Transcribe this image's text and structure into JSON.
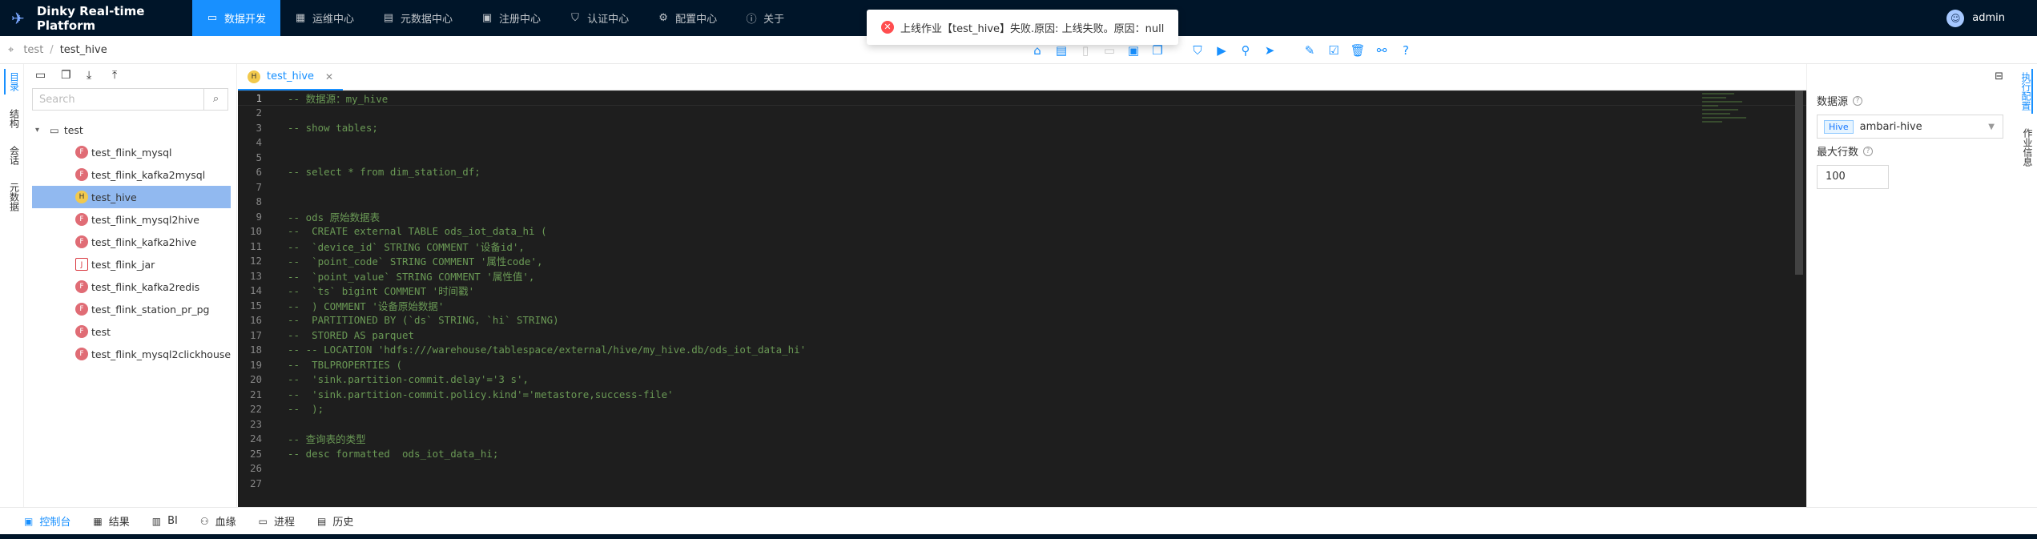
{
  "app": {
    "title": "Dinky Real-time Platform"
  },
  "nav": [
    {
      "label": "数据开发",
      "icon": "data-dev-icon",
      "glyph": "▭",
      "active": true
    },
    {
      "label": "运维中心",
      "icon": "ops-icon",
      "glyph": "▦"
    },
    {
      "label": "元数据中心",
      "icon": "metadata-icon",
      "glyph": "▤"
    },
    {
      "label": "注册中心",
      "icon": "registry-icon",
      "glyph": "▣"
    },
    {
      "label": "认证中心",
      "icon": "shield-icon",
      "glyph": "⛉"
    },
    {
      "label": "配置中心",
      "icon": "gear-icon",
      "glyph": "⚙"
    },
    {
      "label": "关于",
      "icon": "info-icon",
      "glyph": "ⓘ"
    }
  ],
  "user": {
    "name": "admin"
  },
  "toast": {
    "message": "上线作业【test_hive】失败.原因: 上线失败。原因：null"
  },
  "breadcrumb": {
    "root": "test",
    "current": "test_hive"
  },
  "left_rail": [
    {
      "label": "目录",
      "active": true
    },
    {
      "label": "结构"
    },
    {
      "label": "会话"
    },
    {
      "label": "元数据"
    }
  ],
  "search": {
    "placeholder": "Search"
  },
  "tree": {
    "folder": "test",
    "items": [
      {
        "label": "test_flink_mysql",
        "kind": "flink"
      },
      {
        "label": "test_flink_kafka2mysql",
        "kind": "flink"
      },
      {
        "label": "test_hive",
        "kind": "hive",
        "selected": true
      },
      {
        "label": "test_flink_mysql2hive",
        "kind": "flink"
      },
      {
        "label": "test_flink_kafka2hive",
        "kind": "flink"
      },
      {
        "label": "test_flink_jar",
        "kind": "jar"
      },
      {
        "label": "test_flink_kafka2redis",
        "kind": "flink"
      },
      {
        "label": "test_flink_station_pr_pg",
        "kind": "flink"
      },
      {
        "label": "test",
        "kind": "flink"
      },
      {
        "label": "test_flink_mysql2clickhouse",
        "kind": "flink"
      }
    ]
  },
  "editor": {
    "tab_label": "test_hive",
    "lines": [
      "-- 数据源：my_hive",
      "",
      "-- show tables;",
      "",
      "",
      "-- select * from dim_station_df;",
      "",
      "",
      "-- ods 原始数据表",
      "--  CREATE external TABLE ods_iot_data_hi (",
      "--  `device_id` STRING COMMENT '设备id',",
      "--  `point_code` STRING COMMENT '属性code',",
      "--  `point_value` STRING COMMENT '属性值',",
      "--  `ts` bigint COMMENT '时间戳'",
      "--  ) COMMENT '设备原始数据'",
      "--  PARTITIONED BY (`ds` STRING, `hi` STRING)",
      "--  STORED AS parquet",
      "-- -- LOCATION 'hdfs:///warehouse/tablespace/external/hive/my_hive.db/ods_iot_data_hi'",
      "--  TBLPROPERTIES (",
      "--  'sink.partition-commit.delay'='3 s',",
      "--  'sink.partition-commit.policy.kind'='metastore,success-file'",
      "--  );",
      "",
      "-- 查询表的类型",
      "-- desc formatted  ods_iot_data_hi;",
      "",
      ""
    ]
  },
  "right_panel": {
    "datasource_label": "数据源",
    "datasource_tag": "Hive",
    "datasource_value": "ambari-hive",
    "max_rows_label": "最大行数",
    "max_rows_value": "100"
  },
  "right_rail": [
    {
      "label": "执行配置",
      "active": true
    },
    {
      "label": "作业信息"
    }
  ],
  "bottom_tabs": [
    {
      "label": "控制台",
      "icon": "console-icon",
      "glyph": "▣",
      "active": true
    },
    {
      "label": "结果",
      "icon": "table-icon",
      "glyph": "▦"
    },
    {
      "label": "BI",
      "icon": "bar-chart-icon",
      "glyph": "▥"
    },
    {
      "label": "血缘",
      "icon": "lineage-icon",
      "glyph": "⚇"
    },
    {
      "label": "进程",
      "icon": "monitor-icon",
      "glyph": "▭"
    },
    {
      "label": "历史",
      "icon": "calendar-icon",
      "glyph": "▤"
    }
  ]
}
